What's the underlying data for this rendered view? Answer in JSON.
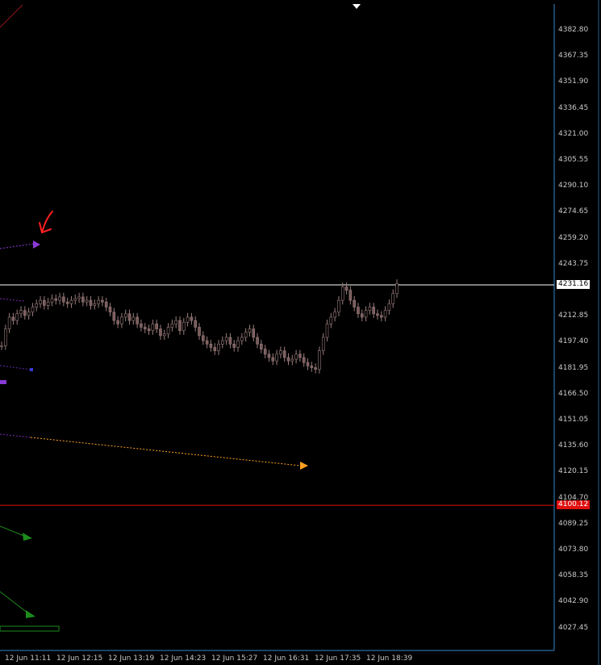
{
  "window": {
    "theme": {
      "background": "#000000",
      "frame": "#1f5a8c",
      "text": "#c8c8c8",
      "candle": "#9a7b7b"
    },
    "price_axis": {
      "labels": [
        "4382.80",
        "4367.35",
        "4351.90",
        "4336.45",
        "4321.00",
        "4305.55",
        "4290.10",
        "4274.65",
        "4259.20",
        "4243.75",
        "4212.85",
        "4197.40",
        "4181.95",
        "4166.50",
        "4151.05",
        "4135.60",
        "4120.15",
        "4104.70",
        "4089.25",
        "4073.80",
        "4058.35",
        "4042.90",
        "4027.45"
      ]
    },
    "time_axis": {
      "labels": [
        "12 Jun 11:11",
        "12 Jun 12:15",
        "12 Jun 13:19",
        "12 Jun 14:23",
        "12 Jun 15:27",
        "12 Jun 16:31",
        "12 Jun 17:35",
        "12 Jun 18:39"
      ]
    },
    "levels": {
      "bid": {
        "label": "4231.16",
        "value": 4231.16,
        "color": "#ffffff"
      },
      "alert": {
        "label": "4100.12",
        "value": 4100.12,
        "color": "#e01010"
      }
    },
    "icons": {
      "scroll": "chart-shift-marker-icon",
      "annotation": "hand-drawn-arrow-icon"
    }
  },
  "chart_data": {
    "type": "candlestick",
    "symbol_price_range": [
      4020,
      4392
    ],
    "series": [
      {
        "name": "",
        "values": [
          4195,
          4205,
          4212,
          4210,
          4214,
          4216,
          4213,
          4215,
          4218,
          4220,
          4222,
          4219,
          4221,
          4223,
          4222,
          4224,
          4221,
          4220,
          4222,
          4223,
          4224,
          4221,
          4222,
          4219,
          4220,
          4222,
          4221,
          4218,
          4215,
          4210,
          4208,
          4212,
          4214,
          4210,
          4212,
          4208,
          4206,
          4205,
          4204,
          4208,
          4205,
          4201,
          4202,
          4206,
          4208,
          4210,
          4204,
          4209,
          4212,
          4210,
          4206,
          4201,
          4198,
          4196,
          4194,
          4192,
          4196,
          4198,
          4200,
          4196,
          4194,
          4198,
          4200,
          4203,
          4205,
          4200,
          4196,
          4193,
          4190,
          4188,
          4186,
          4190,
          4192,
          4188,
          4186,
          4187,
          4190,
          4188,
          4185,
          4183,
          4182,
          4181,
          4192,
          4200,
          4208,
          4212,
          4215,
          4222,
          4230,
          4228,
          4222,
          4218,
          4214,
          4212,
          4216,
          4218,
          4214,
          4213,
          4212,
          4216,
          4220,
          4226,
          4232
        ]
      }
    ],
    "bid_line": 4231.16,
    "alert_line": 4100.12
  }
}
